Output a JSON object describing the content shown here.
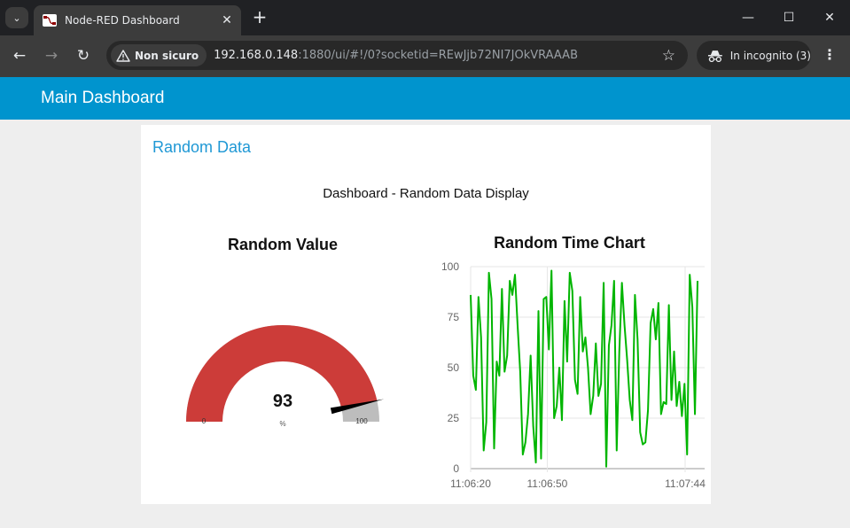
{
  "browser": {
    "tab_title": "Node-RED Dashboard",
    "security_chip": "Non sicuro",
    "url_host": "192.168.0.148",
    "url_rest": ":1880/ui/#!/0?socketid=REwJjb72NI7JOkVRAAAB",
    "incognito_label": "In incognito (3)"
  },
  "dashboard": {
    "title": "Main Dashboard",
    "group_title": "Random Data",
    "text_widget": "Dashboard - Random Data Display",
    "gauge": {
      "title": "Random Value",
      "value": "93",
      "units": "%",
      "min": "0",
      "max": "100",
      "fill_color": "#cc3c39",
      "track_color": "#bdbdbd",
      "needle_color": "#000000"
    }
  },
  "chart_data": {
    "type": "line",
    "title": "Random Time Chart",
    "xlabel": "",
    "ylabel": "",
    "ylim": [
      0,
      100
    ],
    "yticks": [
      "0",
      "25",
      "50",
      "75",
      "100"
    ],
    "xtick_labels": [
      "11:06:20",
      "11:06:50",
      "11:07:44"
    ],
    "x_range": [
      "11:06:20",
      "11:07:44"
    ],
    "grid": true,
    "color": "#00b500",
    "series": [
      {
        "values": [
          86,
          46,
          39,
          85,
          65,
          9,
          23,
          97,
          84,
          10,
          53,
          46,
          89,
          48,
          56,
          93,
          86,
          96,
          71,
          48,
          7,
          13,
          27,
          56,
          21,
          3,
          78,
          5,
          84,
          85,
          59,
          98,
          25,
          31,
          50,
          24,
          83,
          53,
          97,
          88,
          44,
          37,
          85,
          58,
          65,
          50,
          27,
          36,
          62,
          36,
          42,
          92,
          1,
          61,
          71,
          93,
          9,
          58,
          92,
          71,
          54,
          34,
          24,
          86,
          64,
          18,
          12,
          13,
          29,
          72,
          79,
          64,
          82,
          27,
          33,
          32,
          81,
          34,
          58,
          31,
          43,
          26,
          42,
          7,
          96,
          80,
          27,
          93
        ]
      }
    ]
  }
}
